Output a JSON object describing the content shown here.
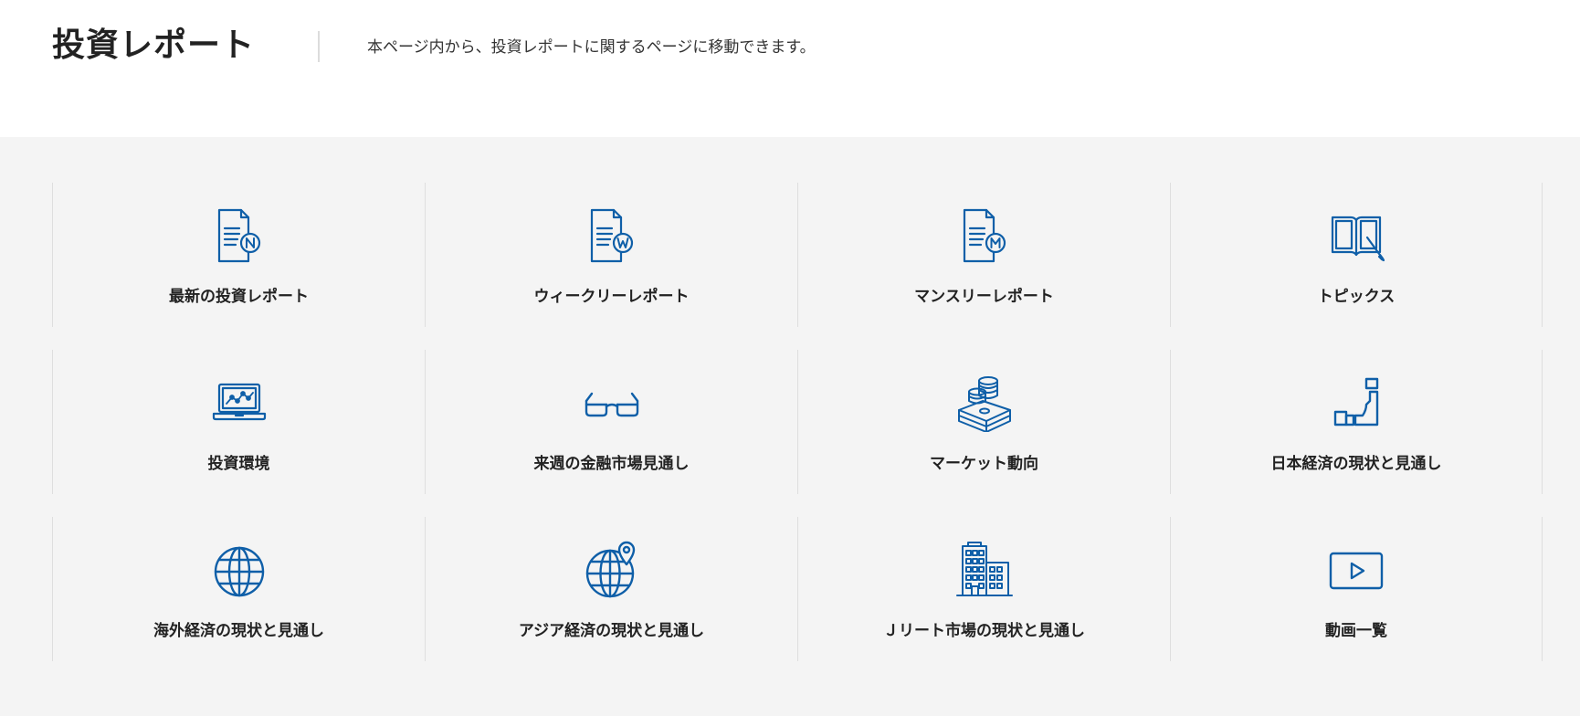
{
  "header": {
    "title": "投資レポート",
    "description": "本ページ内から、投資レポートに関するページに移動できます。"
  },
  "theme": {
    "icon_color": "#0f5fa8",
    "background": "#f4f4f4"
  },
  "tiles": [
    {
      "label": "最新の投資レポート",
      "icon": "document-n-icon"
    },
    {
      "label": "ウィークリーレポート",
      "icon": "document-w-icon"
    },
    {
      "label": "マンスリーレポート",
      "icon": "document-m-icon"
    },
    {
      "label": "トピックス",
      "icon": "open-book-icon"
    },
    {
      "label": "投資環境",
      "icon": "laptop-chart-icon"
    },
    {
      "label": "来週の金融市場見通し",
      "icon": "glasses-icon"
    },
    {
      "label": "マーケット動向",
      "icon": "money-coins-icon"
    },
    {
      "label": "日本経済の現状と見通し",
      "icon": "japan-map-icon"
    },
    {
      "label": "海外経済の現状と見通し",
      "icon": "globe-icon"
    },
    {
      "label": "アジア経済の現状と見通し",
      "icon": "globe-pin-icon"
    },
    {
      "label": "Ｊリート市場の現状と見通し",
      "icon": "buildings-icon"
    },
    {
      "label": "動画一覧",
      "icon": "video-play-icon"
    }
  ]
}
